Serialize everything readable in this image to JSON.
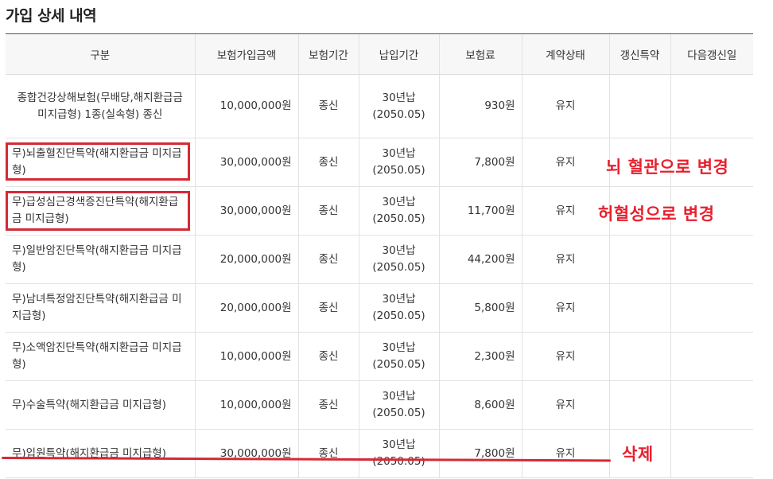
{
  "page": {
    "title": "가입 상세 내역"
  },
  "table": {
    "headers": [
      "구분",
      "보험가입금액",
      "보험기간",
      "납입기간",
      "보험료",
      "계약상태",
      "갱신특약",
      "다음갱신일"
    ],
    "rows": [
      {
        "name": "종합건강상해보험(무배당,해지환급금 미지급형) 1종(실속형) 종신",
        "amount": "10,000,000원",
        "term": "종신",
        "pay_term": "30년납",
        "pay_until": "(2050.05)",
        "premium": "930원",
        "status": "유지",
        "renewal_rider": "",
        "next_renewal": ""
      },
      {
        "name": "무)뇌출혈진단특약(해지환급금 미지급형)",
        "amount": "30,000,000원",
        "term": "종신",
        "pay_term": "30년납",
        "pay_until": "(2050.05)",
        "premium": "7,800원",
        "status": "유지",
        "renewal_rider": "",
        "next_renewal": ""
      },
      {
        "name": "무)급성심근경색증진단특약(해지환급금 미지급형)",
        "amount": "30,000,000원",
        "term": "종신",
        "pay_term": "30년납",
        "pay_until": "(2050.05)",
        "premium": "11,700원",
        "status": "유지",
        "renewal_rider": "",
        "next_renewal": ""
      },
      {
        "name": "무)일반암진단특약(해지환급금 미지급형)",
        "amount": "20,000,000원",
        "term": "종신",
        "pay_term": "30년납",
        "pay_until": "(2050.05)",
        "premium": "44,200원",
        "status": "유지",
        "renewal_rider": "",
        "next_renewal": ""
      },
      {
        "name": "무)남녀특정암진단특약(해지환급금 미지급형)",
        "amount": "20,000,000원",
        "term": "종신",
        "pay_term": "30년납",
        "pay_until": "(2050.05)",
        "premium": "5,800원",
        "status": "유지",
        "renewal_rider": "",
        "next_renewal": ""
      },
      {
        "name": "무)소액암진단특약(해지환급금 미지급형)",
        "amount": "10,000,000원",
        "term": "종신",
        "pay_term": "30년납",
        "pay_until": "(2050.05)",
        "premium": "2,300원",
        "status": "유지",
        "renewal_rider": "",
        "next_renewal": ""
      },
      {
        "name": "무)수술특약(해지환급금 미지급형)",
        "amount": "10,000,000원",
        "term": "종신",
        "pay_term": "30년납",
        "pay_until": "(2050.05)",
        "premium": "8,600원",
        "status": "유지",
        "renewal_rider": "",
        "next_renewal": ""
      },
      {
        "name": "무)입원특약(해지환급금 미지급형)",
        "amount": "30,000,000원",
        "term": "종신",
        "pay_term": "30년납",
        "pay_until": "(2050.05)",
        "premium": "7,800원",
        "status": "유지",
        "renewal_rider": "",
        "next_renewal": ""
      }
    ]
  },
  "annotations": {
    "change_cerebral": "뇌 혈관으로 변경",
    "change_ischemic": "허혈성으로 변경",
    "delete": "삭제",
    "color": "#e8202e"
  }
}
